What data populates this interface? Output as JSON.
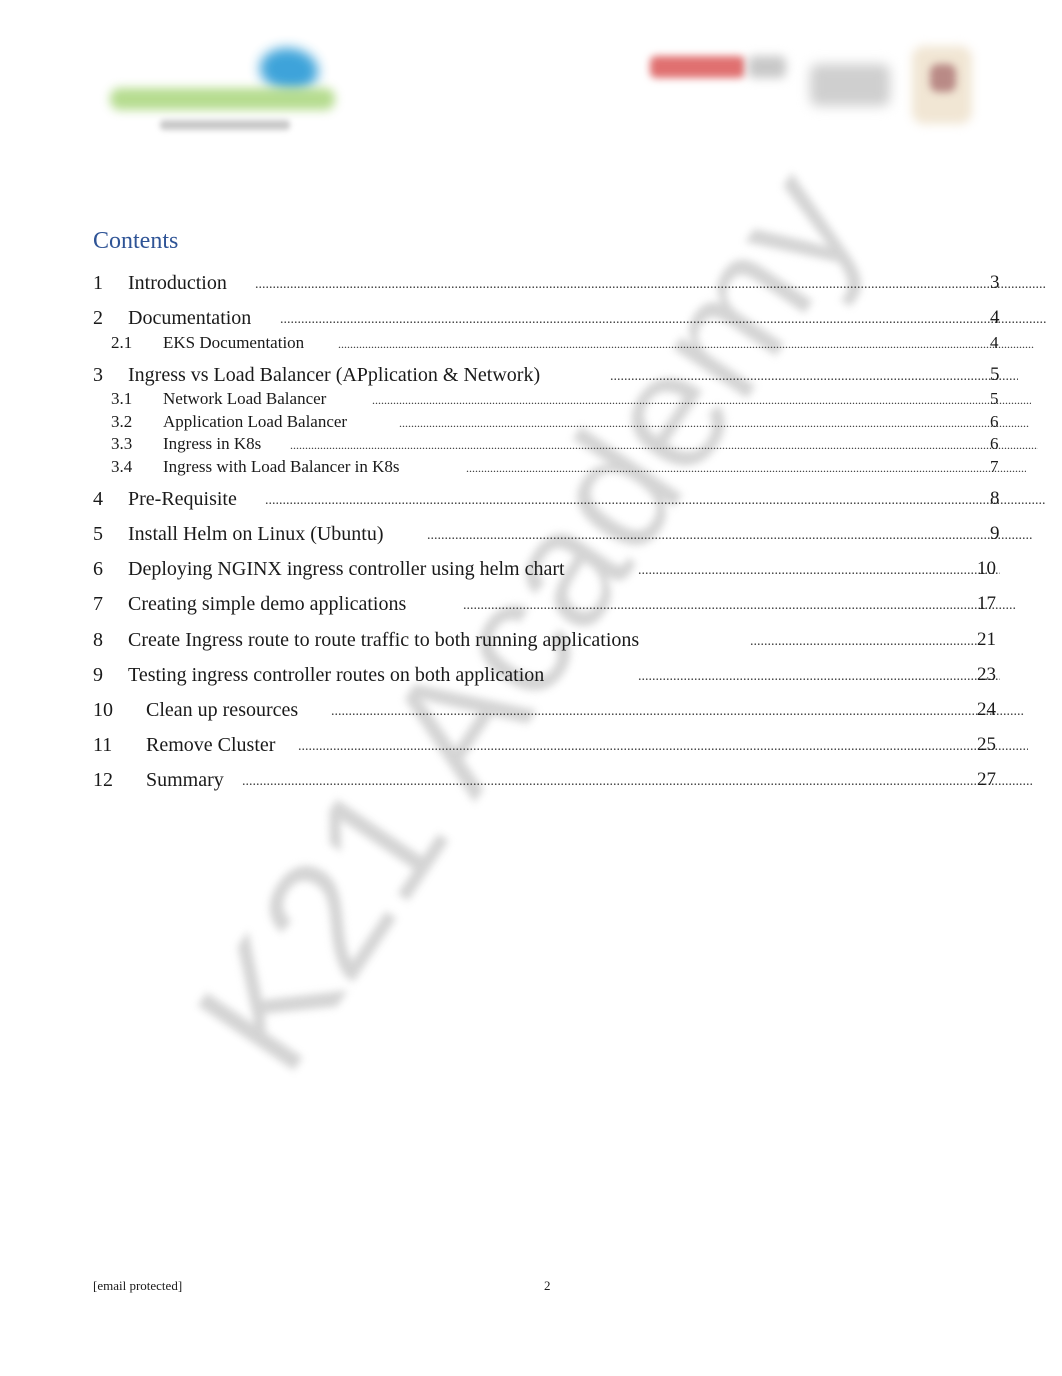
{
  "header": {
    "left_logo": "k21academy-logo",
    "right_logos": [
      "partner-logo-red",
      "partner-logo-grey",
      "partner-logo-crest"
    ]
  },
  "watermark": "K21 Academy",
  "contents": {
    "title": "Contents",
    "entries": [
      {
        "num": "1",
        "title": "Introduction",
        "page": "3",
        "level": 1
      },
      {
        "num": "2",
        "title": "Documentation",
        "page": "4",
        "level": 1
      },
      {
        "num": "2.1",
        "title": "EKS Documentation",
        "page": "4",
        "level": 2
      },
      {
        "num": "3",
        "title": "Ingress vs Load Balancer (APplication & Network)",
        "page": "5",
        "level": 1
      },
      {
        "num": "3.1",
        "title": "Network Load Balancer",
        "page": "5",
        "level": 2
      },
      {
        "num": "3.2",
        "title": "Application Load Balancer",
        "page": "6",
        "level": 2
      },
      {
        "num": "3.3",
        "title": "Ingress in K8s",
        "page": "6",
        "level": 2
      },
      {
        "num": "3.4",
        "title": "Ingress with Load Balancer in K8s",
        "page": "7",
        "level": 2
      },
      {
        "num": "4",
        "title": "Pre-Requisite",
        "page": "8",
        "level": 1
      },
      {
        "num": "5",
        "title": "Install Helm on Linux (Ubuntu)",
        "page": "9",
        "level": 1
      },
      {
        "num": "6",
        "title": "Deploying NGINX ingress controller using helm chart",
        "page": "10",
        "level": 1
      },
      {
        "num": "7",
        "title": "Creating simple demo applications",
        "page": "17",
        "level": 1
      },
      {
        "num": "8",
        "title": "Create Ingress route to route traffic to both running applications",
        "page": "21",
        "level": 1
      },
      {
        "num": "9",
        "title": "Testing ingress controller routes on both application",
        "page": "23",
        "level": 1
      },
      {
        "num": "10",
        "title": "Clean up resources",
        "page": "24",
        "level": 1
      },
      {
        "num": "11",
        "title": "Remove Cluster",
        "page": "25",
        "level": 1
      },
      {
        "num": "12",
        "title": "Summary",
        "page": "27",
        "level": 1
      }
    ]
  },
  "footer": {
    "email": "[email protected]",
    "page_number": "2"
  }
}
